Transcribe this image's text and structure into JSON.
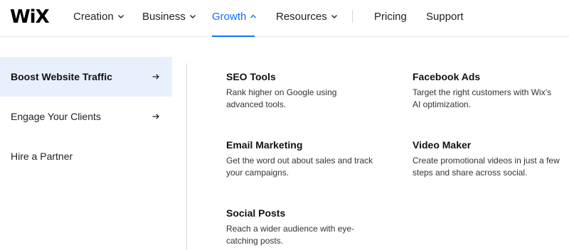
{
  "brand": {
    "logo_text": "WiX"
  },
  "nav": {
    "creation": "Creation",
    "business": "Business",
    "growth": "Growth",
    "resources": "Resources",
    "pricing": "Pricing",
    "support": "Support"
  },
  "colors": {
    "accent": "#116dff",
    "selected_bg": "#e8f0fe"
  },
  "icons": {
    "dropdown": "chevron-down-icon",
    "expanded": "chevron-up-icon",
    "menu_arrow": "arrow-right-icon"
  },
  "menu": {
    "items": [
      {
        "label": "Boost Website Traffic",
        "selected": true
      },
      {
        "label": "Engage Your Clients",
        "selected": false
      },
      {
        "label": "Hire a Partner",
        "selected": false
      }
    ]
  },
  "features": [
    {
      "title": "SEO Tools",
      "description": "Rank higher on Google using advanced tools."
    },
    {
      "title": "Facebook Ads",
      "description": "Target the right customers with Wix’s AI optimization."
    },
    {
      "title": "Email Marketing",
      "description": "Get the word out about sales and track your campaigns."
    },
    {
      "title": "Video Maker",
      "description": "Create promotional videos in just a few steps and share across social."
    },
    {
      "title": "Social Posts",
      "description": "Reach a wider audience with eye-catching posts."
    }
  ]
}
